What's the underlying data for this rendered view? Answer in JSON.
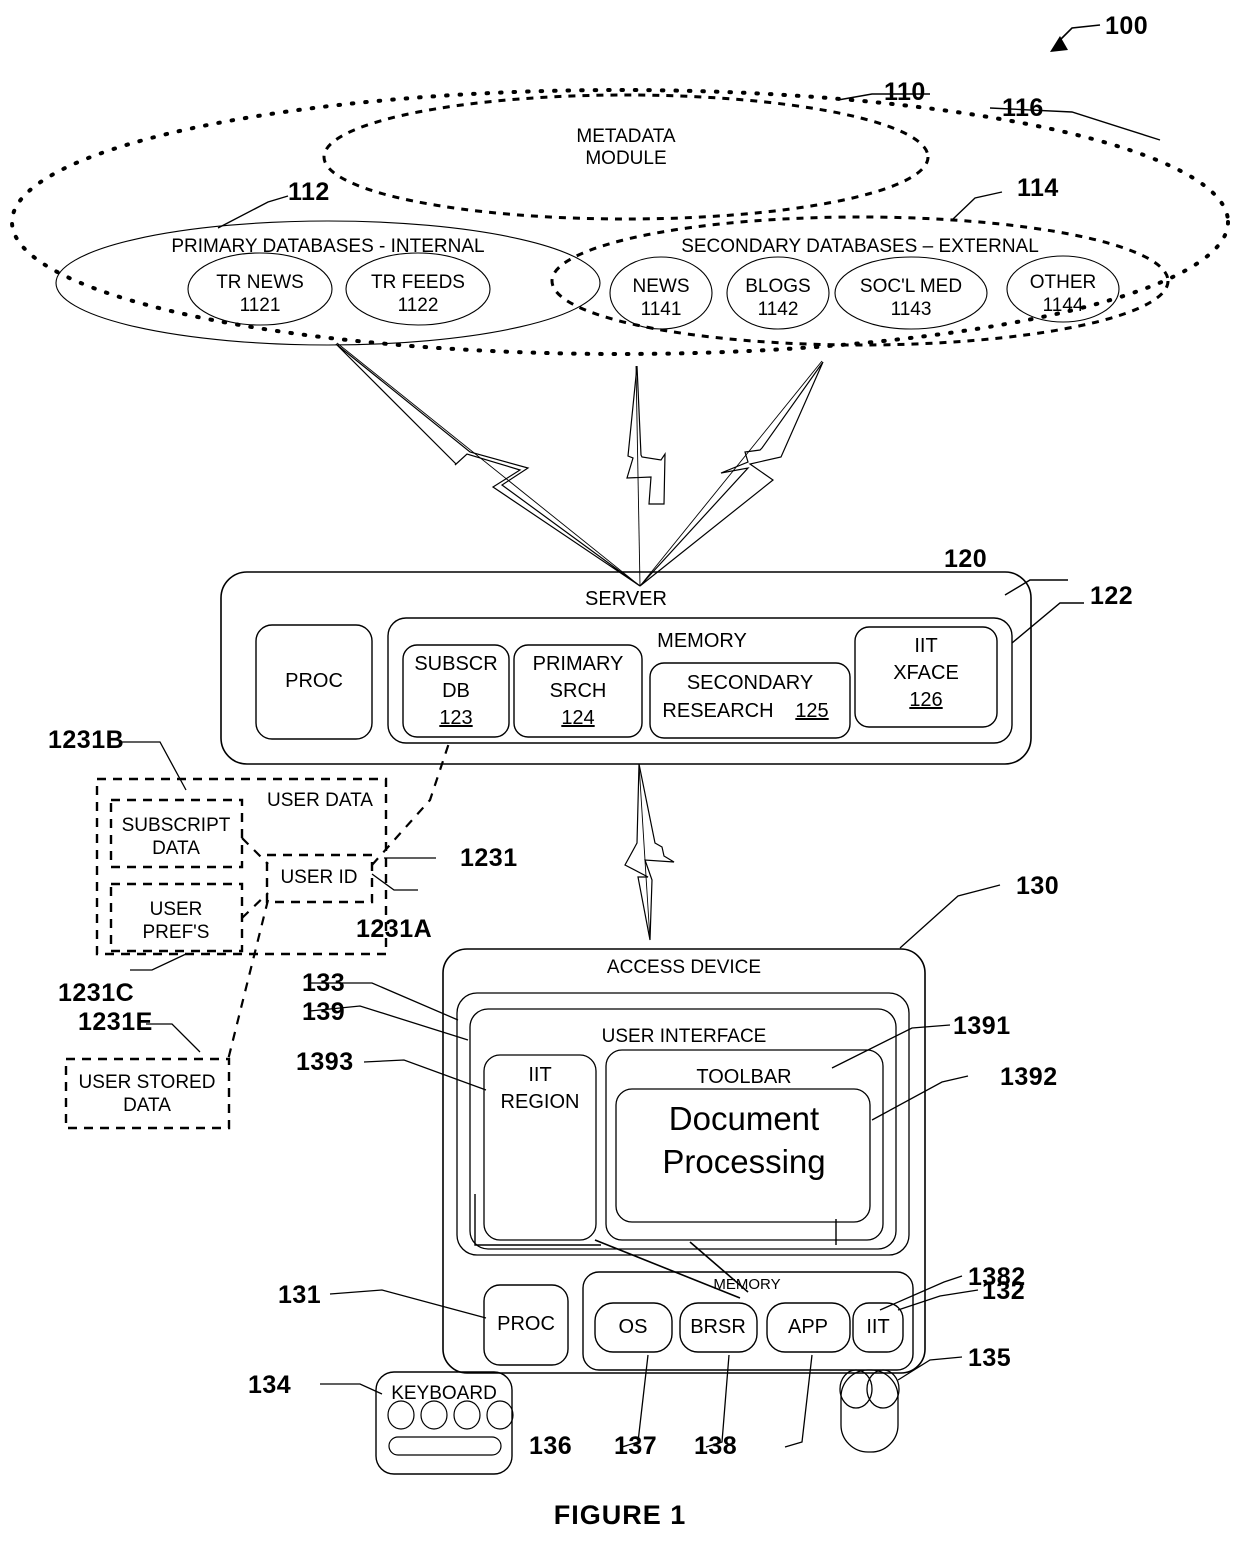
{
  "figure": {
    "caption": "FIGURE 1",
    "system_ref": "100"
  },
  "cloud": {
    "ref": "110",
    "metadata_module": {
      "ref": "116",
      "line1": "METADATA",
      "line2": "MODULE"
    },
    "primary": {
      "ref": "112",
      "title": "PRIMARY DATABASES - INTERNAL",
      "nodes": [
        {
          "label": "TR NEWS",
          "ref": "1121"
        },
        {
          "label": "TR FEEDS",
          "ref": "1122"
        }
      ]
    },
    "secondary": {
      "ref": "114",
      "title": "SECONDARY DATABASES – EXTERNAL",
      "nodes": [
        {
          "label": "NEWS",
          "ref": "1141"
        },
        {
          "label": "BLOGS",
          "ref": "1142"
        },
        {
          "label": "SOC'L MED",
          "ref": "1143"
        },
        {
          "label": "OTHER",
          "ref": "1144"
        }
      ]
    }
  },
  "server": {
    "ref": "120",
    "title": "SERVER",
    "proc_label": "PROC",
    "memory": {
      "ref": "122",
      "title": "MEMORY",
      "blocks": [
        {
          "line1": "SUBSCR",
          "line2": "DB",
          "ref": "123"
        },
        {
          "line1": "PRIMARY",
          "line2": "SRCH",
          "ref": "124"
        },
        {
          "line1": "SECONDARY",
          "line2": "RESEARCH",
          "ref": "125"
        },
        {
          "line1": "IIT",
          "line2": "XFACE",
          "ref": "126"
        }
      ]
    }
  },
  "user_data": {
    "title": "USER DATA",
    "subscript": {
      "line1": "SUBSCRIPT",
      "line2": "DATA",
      "ref": "1231B"
    },
    "prefs": {
      "line1": "USER",
      "line2": "PREF'S",
      "ref": "1231C"
    },
    "user_id": {
      "label": "USER ID",
      "ref": "1231A",
      "block_ref": "1231"
    },
    "stored": {
      "line1": "USER STORED",
      "line2": "DATA",
      "ref": "1231E"
    }
  },
  "access_device": {
    "ref": "130",
    "title": "ACCESS DEVICE",
    "display_ref": "133",
    "ui": {
      "ref": "139",
      "title": "USER INTERFACE",
      "iit_region": {
        "line1": "IIT",
        "line2": "REGION",
        "ref": "1393"
      },
      "toolbar": {
        "label": "TOOLBAR",
        "ref": "1391"
      },
      "document": {
        "line1": "Document",
        "line2": "Processing",
        "ref": "1392"
      }
    },
    "proc": {
      "label": "PROC",
      "ref": "131"
    },
    "memory": {
      "title": "MEMORY",
      "ref": "132",
      "blocks": [
        {
          "label": "OS",
          "ref": "136"
        },
        {
          "label": "BRSR",
          "ref": "137"
        },
        {
          "label": "APP",
          "ref": "138"
        },
        {
          "label": "IIT",
          "ref": "1382"
        }
      ]
    },
    "keyboard": {
      "label": "KEYBOARD",
      "ref": "134"
    },
    "mouse": {
      "ref": "135"
    }
  }
}
